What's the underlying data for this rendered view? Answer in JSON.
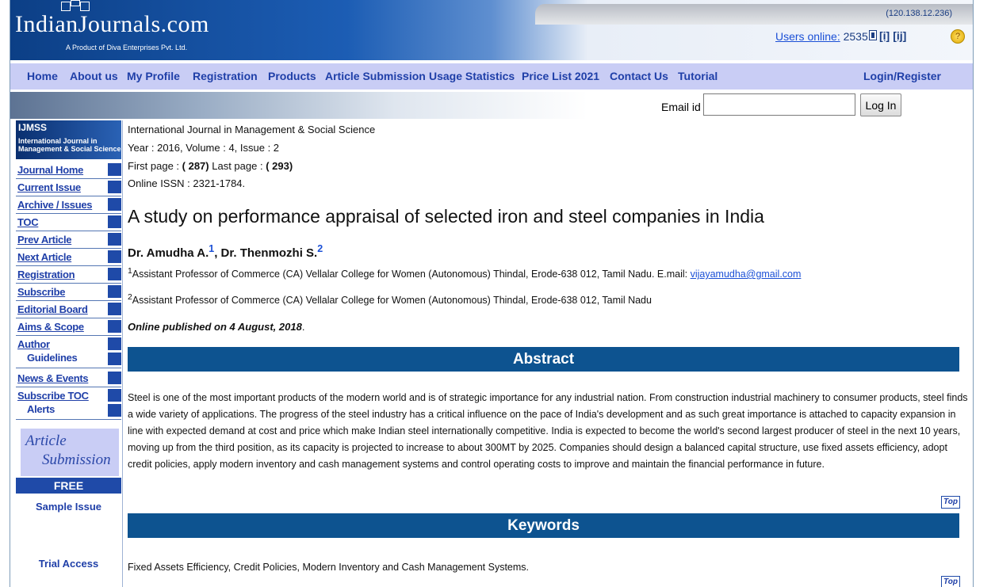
{
  "header": {
    "logo_text": "IndianJournals.com",
    "tagline": "A Product of Diva Enterprises Pvt. Ltd.",
    "ip": "(120.138.12.236)",
    "users_online_label": "Users online:",
    "users_online_count": "2535",
    "issn_icon_1": "[i]",
    "issn_icon_2": "[ij]"
  },
  "nav": {
    "items": [
      "Home",
      "About us",
      "My Profile",
      "Registration",
      "Products",
      "Article Submission",
      "Usage Statistics",
      "Price List 2021",
      "Contact Us",
      "Tutorial"
    ],
    "login_register": "Login/Register"
  },
  "login": {
    "email_label": "Email id",
    "email_value": "",
    "button": "Log In"
  },
  "sidebar": {
    "journal_code": "IJMSS",
    "journal_name_1": "International Journal in",
    "journal_name_2": "Management & Social Science",
    "items": [
      "Journal Home",
      "Current Issue",
      "Archive / Issues",
      "TOC",
      "Prev Article",
      "Next Article",
      "Registration",
      "Subscribe",
      "Editorial Board",
      "Aims & Scope",
      "Author",
      "Guidelines",
      "News & Events",
      "Subscribe TOC",
      "Alerts"
    ],
    "article_submission_1": "Article",
    "article_submission_2": "Submission",
    "free": "FREE",
    "sample_issue": "Sample Issue",
    "trial_access": "Trial Access"
  },
  "article": {
    "journal": "International Journal in Management & Social Science",
    "year_volume": "Year : 2016, Volume : 4, Issue : 2",
    "first_page_label": "First page :",
    "first_page": "( 287)",
    "last_page_label": "Last page :",
    "last_page": "( 293)",
    "issn": "Online ISSN : 2321-1784.",
    "title": "A study on performance appraisal of selected iron and steel companies in India",
    "author_1": "Dr. Amudha A.",
    "author_1_sup": "1",
    "author_sep": ", ",
    "author_2": "Dr. Thenmozhi S.",
    "author_2_sup": "2",
    "affil_1_sup": "1",
    "affil_1": "Assistant Professor of Commerce (CA) Vellalar College for Women (Autonomous) Thindal, Erode-638 012, Tamil Nadu. E.mail: ",
    "affil_1_email": "vijayamudha@gmail.com",
    "affil_2_sup": "2",
    "affil_2": "Assistant Professor of Commerce (CA) Vellalar College for Women (Autonomous) Thindal, Erode-638 012, Tamil Nadu",
    "published": "Online published on 4 August, 2018",
    "published_dot": ".",
    "abstract_heading": "Abstract",
    "abstract": "Steel is one of the most important products of the modern world and is of strategic importance for any industrial nation. From construction industrial machinery to consumer products, steel finds a wide variety of applications. The progress of the steel industry has a critical influence on the pace of India's development and as such great importance is attached to capacity expansion in line with expected demand at cost and price which make Indian steel internationally competitive. India is expected to become the world's second largest producer of steel in the next 10 years, moving up from the third position, as its capacity is projected to increase to about 300MT by 2025. Companies should design a balanced capital structure, use fixed assets efficiency, adopt credit policies, apply modern inventory and cash management systems and control operating costs to improve and maintain the financial performance in future.",
    "top_label": "Top",
    "keywords_heading": "Keywords",
    "keywords": "Fixed Assets Efficiency, Credit Policies, Modern Inventory and Cash Management Systems."
  }
}
